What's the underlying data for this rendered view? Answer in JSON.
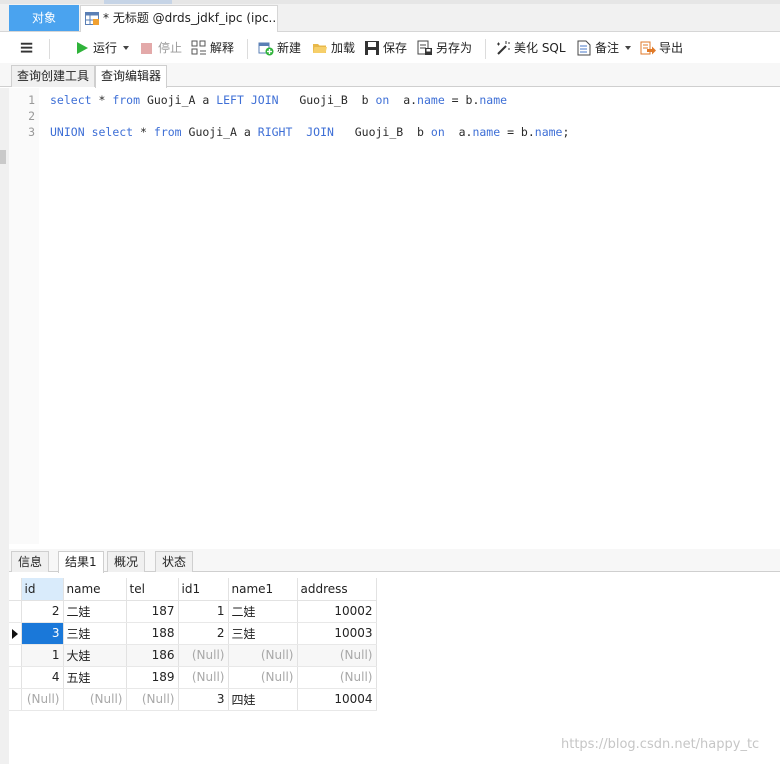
{
  "tabs": {
    "objects_label": "对象",
    "doc_label": "* 无标题 @drds_jdkf_ipc (ipc..."
  },
  "toolbar": {
    "menu_icon": "hamburger-icon",
    "run_label": "运行",
    "stop_label": "停止",
    "explain_label": "解释",
    "new_label": "新建",
    "load_label": "加载",
    "save_label": "保存",
    "save_as_label": "另存为",
    "beautify_label": "美化 SQL",
    "note_label": "备注",
    "export_label": "导出"
  },
  "subtabs": {
    "builder_label": "查询创建工具",
    "editor_label": "查询编辑器"
  },
  "editor": {
    "lines": [
      {
        "num": "1",
        "tokens": [
          {
            "t": "select",
            "k": true
          },
          {
            "t": " * ",
            "k": false
          },
          {
            "t": "from",
            "k": true
          },
          {
            "t": " Guoji_A a ",
            "k": false
          },
          {
            "t": "LEFT",
            "k": true
          },
          {
            "t": " ",
            "k": false
          },
          {
            "t": "JOIN",
            "k": true
          },
          {
            "t": "   Guoji_B  b ",
            "k": false
          },
          {
            "t": "on",
            "k": true
          },
          {
            "t": "  a.",
            "k": false
          },
          {
            "t": "name",
            "k": true
          },
          {
            "t": " = b.",
            "k": false
          },
          {
            "t": "name",
            "k": true
          }
        ]
      },
      {
        "num": "2",
        "tokens": []
      },
      {
        "num": "3",
        "tokens": [
          {
            "t": "UNION",
            "k": true
          },
          {
            "t": " ",
            "k": false
          },
          {
            "t": "select",
            "k": true
          },
          {
            "t": " * ",
            "k": false
          },
          {
            "t": "from",
            "k": true
          },
          {
            "t": " Guoji_A a ",
            "k": false
          },
          {
            "t": "RIGHT",
            "k": true
          },
          {
            "t": "  ",
            "k": false
          },
          {
            "t": "JOIN",
            "k": true
          },
          {
            "t": "   Guoji_B  b ",
            "k": false
          },
          {
            "t": "on",
            "k": true
          },
          {
            "t": "  a.",
            "k": false
          },
          {
            "t": "name",
            "k": true
          },
          {
            "t": " = b.",
            "k": false
          },
          {
            "t": "name",
            "k": true
          },
          {
            "t": ";",
            "k": false
          }
        ]
      }
    ]
  },
  "results": {
    "tabs": [
      "信息",
      "结果1",
      "概况",
      "状态"
    ],
    "active_tab": 1,
    "columns": [
      "id",
      "name",
      "tel",
      "id1",
      "name1",
      "address"
    ],
    "rows": [
      [
        "2",
        "二娃",
        "187",
        "1",
        "二娃",
        "10002"
      ],
      [
        "3",
        "三娃",
        "188",
        "2",
        "三娃",
        "10003"
      ],
      [
        "1",
        "大娃",
        "186",
        "(Null)",
        "(Null)",
        "(Null)"
      ],
      [
        "4",
        "五娃",
        "189",
        "(Null)",
        "(Null)",
        "(Null)"
      ],
      [
        "(Null)",
        "(Null)",
        "(Null)",
        "3",
        "四娃",
        "10004"
      ]
    ],
    "current_row": 1
  },
  "watermark": "https://blog.csdn.net/happy_tc",
  "colors": {
    "accent_tab": "#4aa3ef",
    "keyword": "#3e6fd6",
    "selected_cell": "#1a78d9",
    "null_text": "#a8a8a8"
  }
}
